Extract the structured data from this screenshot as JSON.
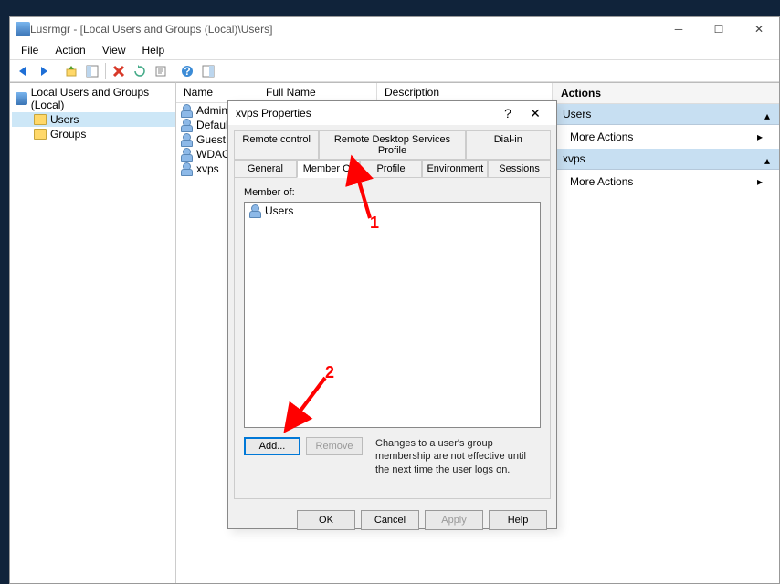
{
  "main": {
    "title": "Lusrmgr - [Local Users and Groups (Local)\\Users]",
    "menus": [
      "File",
      "Action",
      "View",
      "Help"
    ],
    "tree": {
      "root": "Local Users and Groups (Local)",
      "children": [
        "Users",
        "Groups"
      ]
    },
    "list": {
      "cols": [
        "Name",
        "Full Name",
        "Description"
      ],
      "rows": [
        "Administrator",
        "DefaultAccount",
        "Guest",
        "WDAGUtilityAccount",
        "xvps"
      ]
    },
    "actions": {
      "title": "Actions",
      "groups": [
        {
          "label": "Users",
          "item": "More Actions"
        },
        {
          "label": "xvps",
          "item": "More Actions"
        }
      ]
    }
  },
  "dialog": {
    "title": "xvps Properties",
    "tabs_row1": [
      "Remote control",
      "Remote Desktop Services Profile",
      "Dial-in"
    ],
    "tabs_row2": [
      "General",
      "Member Of",
      "Profile",
      "Environment",
      "Sessions"
    ],
    "member_of_label": "Member of:",
    "member_of_items": [
      "Users"
    ],
    "add_btn": "Add...",
    "remove_btn": "Remove",
    "note": "Changes to a user's group membership are not effective until the next time the user logs on.",
    "footer": {
      "ok": "OK",
      "cancel": "Cancel",
      "apply": "Apply",
      "help": "Help"
    }
  },
  "annotations": {
    "a1": "1",
    "a2": "2"
  }
}
